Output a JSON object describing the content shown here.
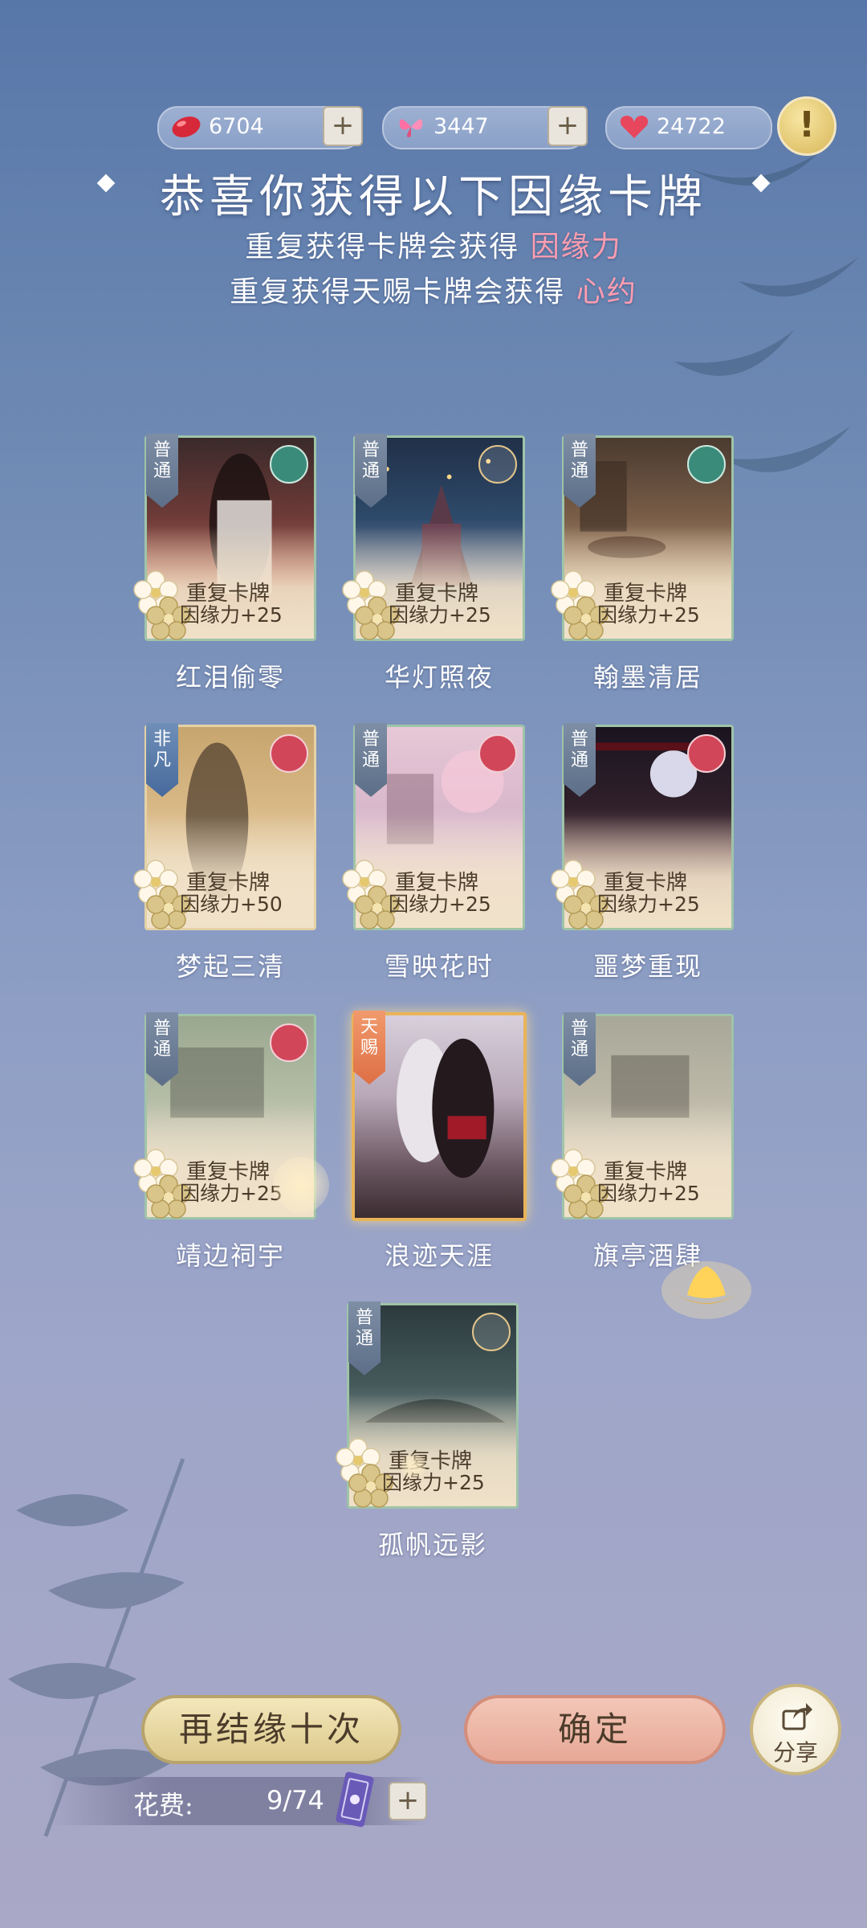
{
  "currencies": [
    {
      "icon": "red-bean-icon",
      "value": "6704"
    },
    {
      "icon": "butterfly-icon",
      "value": "3447"
    },
    {
      "icon": "heart-icon",
      "value": "24722"
    }
  ],
  "alert_symbol": "!",
  "header": {
    "title": "恭喜你获得以下因缘卡牌",
    "line1_prefix": "重复获得卡牌会获得",
    "line1_highlight": "因缘力",
    "line2_prefix": "重复获得天赐卡牌会获得",
    "line2_highlight": "心约"
  },
  "cards": [
    {
      "rarity": "普通",
      "dup_title": "重复卡牌",
      "dup_reward": "因缘力+25",
      "name": "红泪偷零"
    },
    {
      "rarity": "普通",
      "dup_title": "重复卡牌",
      "dup_reward": "因缘力+25",
      "name": "华灯照夜"
    },
    {
      "rarity": "普通",
      "dup_title": "重复卡牌",
      "dup_reward": "因缘力+25",
      "name": "翰墨清居"
    },
    {
      "rarity": "非凡",
      "dup_title": "重复卡牌",
      "dup_reward": "因缘力+50",
      "name": "梦起三清"
    },
    {
      "rarity": "普通",
      "dup_title": "重复卡牌",
      "dup_reward": "因缘力+25",
      "name": "雪映花时"
    },
    {
      "rarity": "普通",
      "dup_title": "重复卡牌",
      "dup_reward": "因缘力+25",
      "name": "噩梦重现"
    },
    {
      "rarity": "普通",
      "dup_title": "重复卡牌",
      "dup_reward": "因缘力+25",
      "name": "靖边祠宇"
    },
    {
      "rarity": "天赐",
      "name": "浪迹天涯"
    },
    {
      "rarity": "普通",
      "dup_title": "重复卡牌",
      "dup_reward": "因缘力+25",
      "name": "旗亭酒肆"
    },
    {
      "rarity": "普通",
      "dup_title": "重复卡牌",
      "dup_reward": "因缘力+25",
      "name": "孤帆远影"
    }
  ],
  "buttons": {
    "again": "再结缘十次",
    "confirm": "确定",
    "share": "分享"
  },
  "cost": {
    "label": "花费:",
    "value": "9/74"
  }
}
